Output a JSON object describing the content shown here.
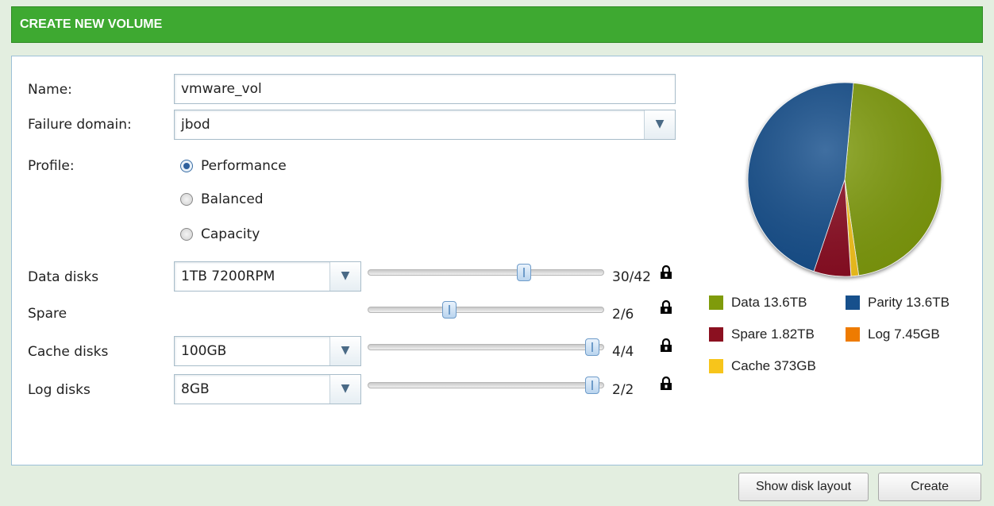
{
  "title": "CREATE NEW VOLUME",
  "form": {
    "name_label": "Name:",
    "name_value": "vmware_vol",
    "failure_domain_label": "Failure domain:",
    "failure_domain_value": "jbod",
    "profile_label": "Profile:",
    "profiles": [
      {
        "label": "Performance",
        "selected": true
      },
      {
        "label": "Balanced",
        "selected": false
      },
      {
        "label": "Capacity",
        "selected": false
      }
    ]
  },
  "disks": [
    {
      "label": "Data disks",
      "select": "1TB 7200RPM",
      "count": "30/42",
      "value": 30,
      "max": 42
    },
    {
      "label": "Spare",
      "select": "",
      "count": "2/6",
      "value": 2,
      "max": 6
    },
    {
      "label": "Cache disks",
      "select": "100GB",
      "count": "4/4",
      "value": 4,
      "max": 4
    },
    {
      "label": "Log disks",
      "select": "8GB",
      "count": "2/2",
      "value": 2,
      "max": 2
    }
  ],
  "legend": [
    {
      "label": "Data 13.6TB",
      "color": "#7f9b0b"
    },
    {
      "label": "Parity 13.6TB",
      "color": "#17508c"
    },
    {
      "label": "Spare 1.82TB",
      "color": "#8b1020"
    },
    {
      "label": "Log 7.45GB",
      "color": "#ee7b00"
    },
    {
      "label": "Cache 373GB",
      "color": "#f7c51b"
    }
  ],
  "chart_data": {
    "type": "pie",
    "categories": [
      "Data",
      "Parity",
      "Spare",
      "Log",
      "Cache"
    ],
    "values": [
      13600,
      13600,
      1820,
      7.45,
      373
    ],
    "units": "GB"
  },
  "buttons": {
    "show_layout": "Show disk layout",
    "create": "Create"
  }
}
